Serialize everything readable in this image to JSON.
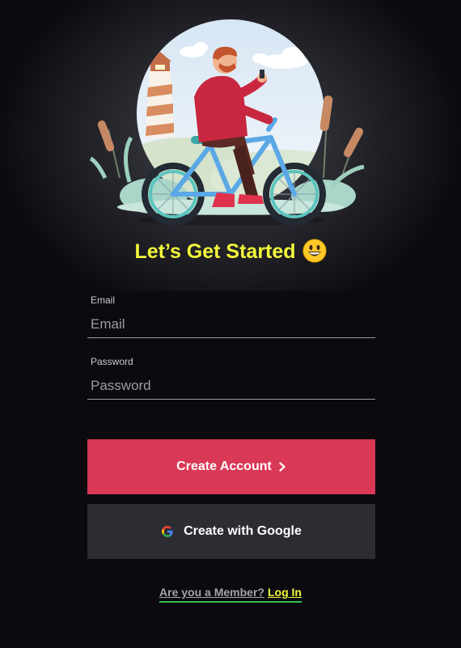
{
  "hero": {
    "title": "Let’s Get Started",
    "emoji_icon": "grinning-face-icon"
  },
  "form": {
    "email": {
      "label": "Email",
      "placeholder": "Email",
      "value": ""
    },
    "password": {
      "label": "Password",
      "placeholder": "Password",
      "value": ""
    }
  },
  "actions": {
    "create_account_label": "Create Account",
    "create_account_icon": "chevron-right-icon",
    "google_label": "Create with Google",
    "google_icon": "google-g-icon"
  },
  "footer": {
    "member_question": "Are you a Member?",
    "login_label": "Log In"
  },
  "colors": {
    "background": "#0b0b0f",
    "heading": "#f3f73a",
    "primary_button": "#d93856",
    "secondary_button": "#2c2c33",
    "login_link": "#f3f73a",
    "underline_accent": "#33c04a"
  }
}
